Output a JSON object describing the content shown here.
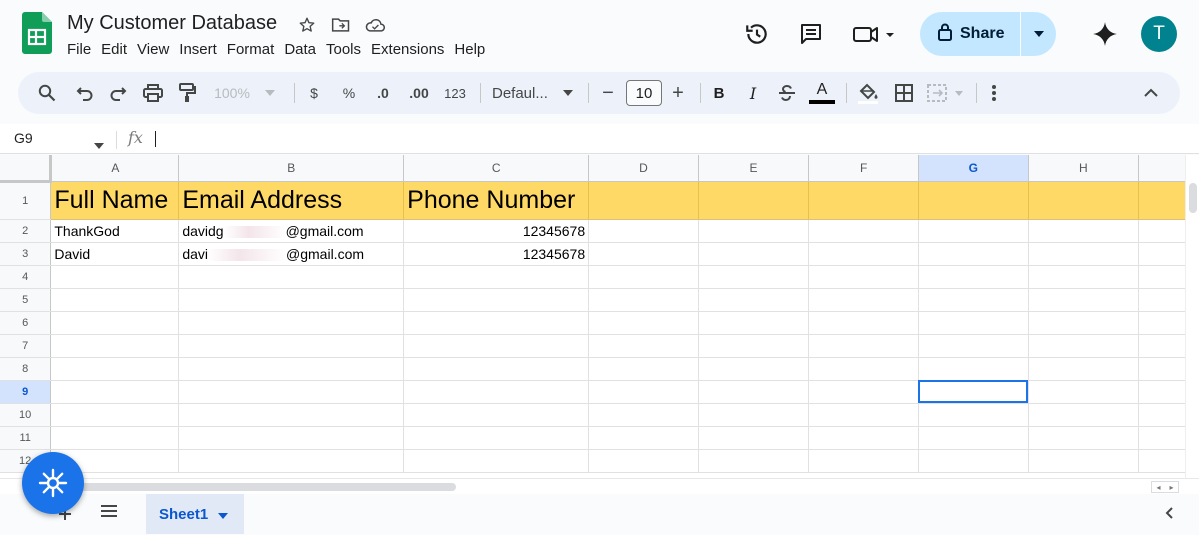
{
  "doc": {
    "title": "My Customer Database"
  },
  "menu": [
    "File",
    "Edit",
    "View",
    "Insert",
    "Format",
    "Data",
    "Tools",
    "Extensions",
    "Help"
  ],
  "share": {
    "label": "Share"
  },
  "user": {
    "initial": "T"
  },
  "toolbar": {
    "zoom": "100%",
    "currency": "$",
    "percent": "%",
    "dec_decrease": ".0",
    "dec_increase": ".00",
    "number_format": "123",
    "font": "Defaul...",
    "font_size": "10",
    "minus": "−",
    "plus": "+",
    "bold": "B",
    "italic": "I",
    "text_color": "A"
  },
  "formula_bar": {
    "cell_ref": "G9",
    "fx": "fx"
  },
  "grid": {
    "columns": [
      "A",
      "B",
      "C",
      "D",
      "E",
      "F",
      "G",
      "H"
    ],
    "rows": [
      "1",
      "2",
      "3",
      "4",
      "5",
      "6",
      "7",
      "8",
      "9",
      "10",
      "11",
      "12"
    ],
    "header": {
      "a": "Full Name",
      "b": "Email Address",
      "c": "Phone Number"
    },
    "data": [
      {
        "name": "ThankGod",
        "email_prefix": "davidg",
        "email_suffix": "@gmail.com",
        "phone": "12345678"
      },
      {
        "name": "David",
        "email_prefix": "davi",
        "email_suffix": "@gmail.com",
        "phone": "12345678"
      }
    ],
    "selected_cell": "G9",
    "header_fill": "#ffd966"
  },
  "sheets": [
    {
      "name": "Sheet1"
    }
  ],
  "colors": {
    "accent": "#1a73e8",
    "share_bg": "#c2e7ff",
    "avatar": "#00838f",
    "logo": "#0f9d58"
  }
}
